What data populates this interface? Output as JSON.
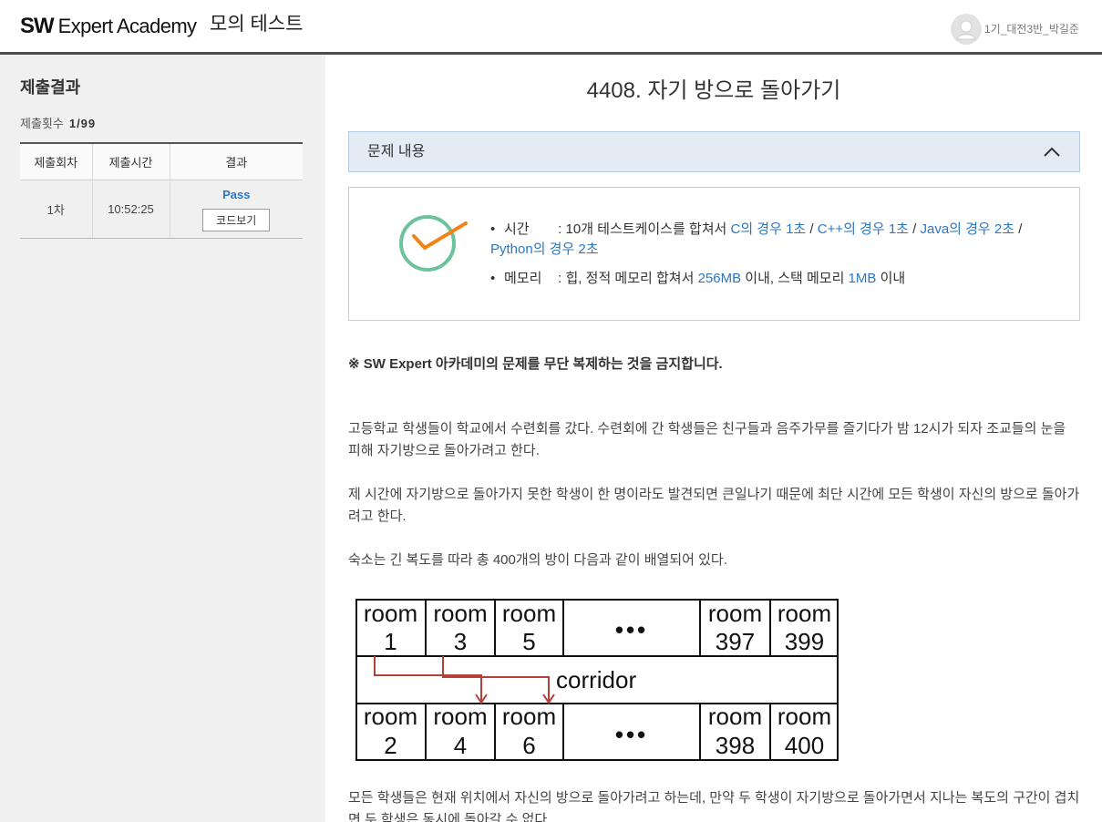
{
  "header": {
    "logo_sw": "SW",
    "logo_text": "Expert Academy",
    "section_title": "모의 테스트",
    "user_name": "1기_대전3반_박길준",
    "avatar_icon": "user-avatar-icon"
  },
  "sidebar": {
    "title": "제출결과",
    "submit_count_label": "제출횟수",
    "submit_count_value": "1/99",
    "table": {
      "headers": [
        "제출회차",
        "제출시간",
        "결과"
      ],
      "rows": [
        {
          "round": "1차",
          "time": "10:52:25",
          "result": "Pass",
          "action": "코드보기"
        }
      ]
    }
  },
  "problem": {
    "title": "4408. 자기 방으로 돌아가기",
    "panel_title": "문제 내용",
    "panel_icon": "chevron-up-icon",
    "status_icon": "check-circle-icon",
    "limits": {
      "bullet": "•",
      "time": {
        "label": "시간",
        "prefix": ": 10개 테스트케이스를 합쳐서",
        "separator": "/",
        "c": "C의 경우 1초",
        "cpp": "C++의 경우 1초",
        "java": "Java의 경우 2초",
        "python": "Python의 경우 2초"
      },
      "memory": {
        "label": "메모리",
        "prefix": ": 힙, 정적 메모리 합쳐서",
        "heap": "256MB",
        "middle": "이내, 스택 메모리",
        "stack": "1MB",
        "suffix": "이내"
      }
    },
    "notice": "※ SW Expert 아카데미의 문제를 무단 복제하는 것을 금지합니다.",
    "paragraphs": [
      "고등학교 학생들이 학교에서 수련회를 갔다. 수련회에 간 학생들은 친구들과 음주가무를 즐기다가 밤 12시가 되자 조교들의 눈을 피해 자기방으로 돌아가려고 한다.",
      "제 시간에 자기방으로 돌아가지 못한 학생이 한 명이라도 발견되면 큰일나기 때문에 최단 시간에 모든 학생이 자신의 방으로 돌아가려고 한다.",
      "숙소는 긴 복도를 따라 총 400개의 방이 다음과 같이 배열되어 있다."
    ],
    "diagram": {
      "room_word": "room",
      "top_rooms": [
        "1",
        "3",
        "5",
        "397",
        "399"
      ],
      "bottom_rooms": [
        "2",
        "4",
        "6",
        "398",
        "400"
      ],
      "ellipsis": "•••",
      "corridor_label": "corridor"
    },
    "after_diagram": "모든 학생들은 현재 위치에서 자신의 방으로 돌아가려고 하는데, 만약 두 학생이 자기방으로 돌아가면서 지나는 복도의 구간이 겹치면 두 학생은 동시에 돌아갈 수 없다."
  },
  "colors": {
    "accent_blue": "#2b78c2",
    "panel_header_bg": "#e3ecf5",
    "check_green": "#6cc39b",
    "check_orange": "#f08418",
    "arrow_red": "#b5403a",
    "header_bar": "#4d4d4d",
    "sidebar_bg": "#f0f0f0"
  }
}
